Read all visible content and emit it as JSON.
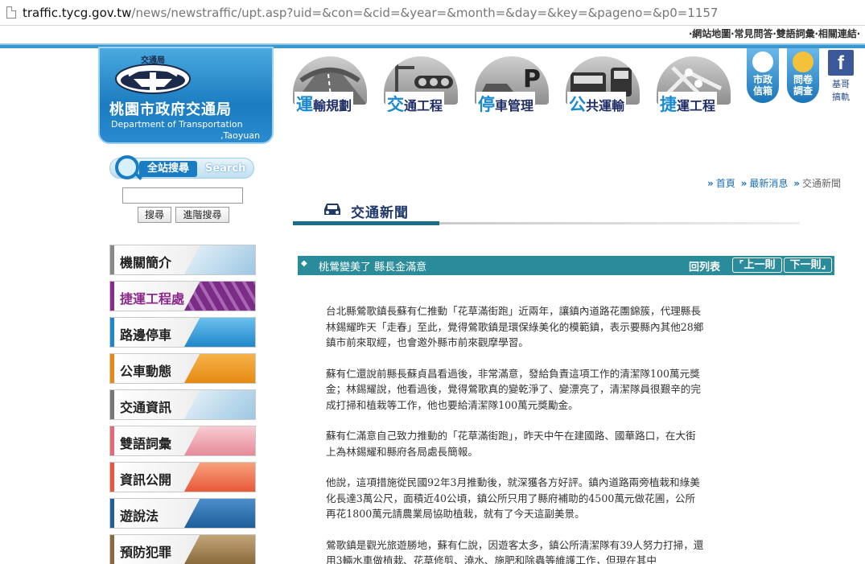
{
  "browser": {
    "url_host": "traffic.tycg.gov.tw",
    "url_rest": "/news/newstraffic/upt.asp?uid=&con=&cid=&year=&month=&day=&key=&pageno=&p0=1157"
  },
  "top_links": "‧網站地圖‧常見問答‧雙語詞彙‧相關連結‧",
  "logo": {
    "emblem_text": "交通局",
    "title": "桃園市政府交通局",
    "english_line1": "Department of Transportation",
    "english_line2": ",Taoyuan"
  },
  "top_nav": [
    {
      "first": "運",
      "rest": "輸規劃"
    },
    {
      "first": "交",
      "rest": "通工程"
    },
    {
      "first": "停",
      "rest": "車管理"
    },
    {
      "first": "公",
      "rest": "共運輸"
    },
    {
      "first": "捷",
      "rest": "運工程"
    }
  ],
  "side_icons": {
    "mail_line1": "市政",
    "mail_line2": "信箱",
    "survey_line1": "問卷",
    "survey_line2": "調查",
    "fb_letter": "f",
    "fb_line1": "基哥",
    "fb_line2": "搞軌"
  },
  "search": {
    "badge_zh": "全站搜尋",
    "badge_en": "Search",
    "input_value": "",
    "search_label": "搜尋",
    "advanced_label": "進階搜尋"
  },
  "left_menu": [
    {
      "label": "機關簡介",
      "bar": "#888888",
      "pic": "#b9d7ea"
    },
    {
      "label": "捷運工程處",
      "bar": "#8a2a8a",
      "pic": "#7a2c86",
      "accent": "#8a2a8a"
    },
    {
      "label": "路邊停車",
      "bar": "#1e87c9",
      "pic": "#3aa6e0"
    },
    {
      "label": "公車動態",
      "bar": "#e58a12",
      "pic": "#f2a02a"
    },
    {
      "label": "交通資訊",
      "bar": "#777777",
      "pic": "#b9d7ea"
    },
    {
      "label": "雙語詞彙",
      "bar": "#e06a78",
      "pic": "#f5b6c1"
    },
    {
      "label": "資訊公開",
      "bar": "#e8583a",
      "pic": "#f28a5a"
    },
    {
      "label": "遊說法",
      "bar": "#1e5f9a",
      "pic": "#2f75b5"
    },
    {
      "label": "預防犯罪",
      "bar": "#8a6a3a",
      "pic": "#a58558"
    }
  ],
  "breadcrumb": {
    "home": "首頁",
    "latest": "最新消息",
    "current": "交通新聞"
  },
  "section": {
    "title": "交通新聞"
  },
  "news": {
    "title": "桃鶯變美了 縣長金滿意",
    "back_label": "回列表",
    "prev_label": "上一則",
    "next_label": "下一則"
  },
  "article": {
    "paragraphs": [
      "台北縣鶯歌鎮長蘇有仁推動「花草滿街跑」近兩年，讓鎮內道路花團錦簇，代理縣長林錫耀昨天「走春」至此，覺得鶯歌鎮是環保綠美化的模範鎮，表示要縣內其他28鄉鎮市前來取經，也會邀外縣市前來觀摩學習。",
      "蘇有仁還說前縣長蘇貞昌看過後，非常滿意，發給負責這項工作的清潔隊100萬元獎金；林錫耀說，他看過後，覺得鶯歌真的變乾淨了、變漂亮了，清潔隊員很艱辛的完成打掃和植栽等工作，他也要給清潔隊100萬元獎勵金。",
      "蘇有仁滿意自己致力推動的「花草滿街跑」，昨天中午在建國路、國華路口，在大街上為林錫耀和縣府各局處長簡報。",
      "他說，這項措施從民國92年3月推動後，就深獲各方好評。鎮內道路兩旁植栽和綠美化長達3萬公尺，面積近40公頃，鎮公所只用了縣府補助的4500萬元做花圃，公所再花1800萬元請農業局協助植栽，就有了今天這副美景。",
      "鶯歌鎮是觀光旅遊勝地，蘇有仁說，因遊客太多，鎮公所清潔隊有39人努力打掃，還用3輛水車做植栽、花草修剪、澆水、施肥和除蟲等維護工作，但現在其中"
    ]
  },
  "colors": {
    "brand_blue": "#1a7dc4",
    "news_bar": "#2a8c9a",
    "heading_navy": "#1f3a6a"
  }
}
